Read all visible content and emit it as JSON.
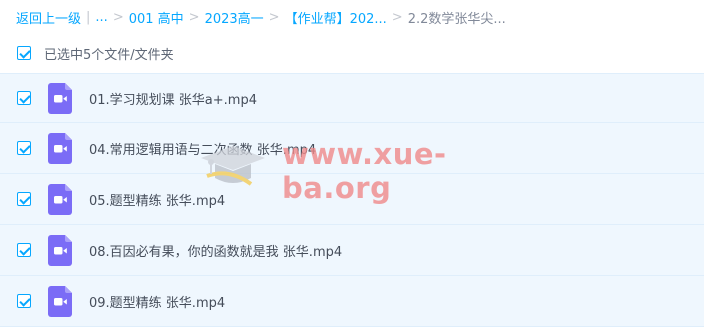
{
  "breadcrumb": {
    "back": "返回上一级",
    "ellipsis": "...",
    "items": [
      "001 高中",
      "2023高一",
      "【作业帮】202...",
      "2.2数学张华尖..."
    ],
    "separator": ">"
  },
  "selection": {
    "text": "已选中5个文件/文件夹"
  },
  "files": [
    {
      "name": "01.学习规划课 张华a+.mp4"
    },
    {
      "name": "04.常用逻辑用语与二次函数 张华.mp4"
    },
    {
      "name": "05.题型精练 张华.mp4"
    },
    {
      "name": "08.百因必有果，你的函数就是我 张华.mp4"
    },
    {
      "name": "09.题型精练 张华.mp4"
    }
  ],
  "watermark": {
    "text": "www.xue-ba.org"
  },
  "colors": {
    "accent": "#06a7ff",
    "row_bg": "#eff7fe",
    "video_icon": "#7b6cf6",
    "watermark": "#f08a8a"
  }
}
